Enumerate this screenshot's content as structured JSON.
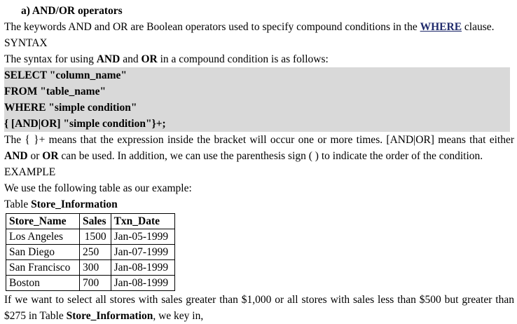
{
  "heading": "a) AND/OR operators",
  "intro": {
    "before": "The keywords AND and OR are Boolean operators used to specify compound conditions in the ",
    "keyword": "WHERE",
    "after": " clause."
  },
  "syntax_label": "SYNTAX",
  "syntax_intro": {
    "part1": "The syntax for using ",
    "and": "AND",
    "part2": " and ",
    "or": "OR",
    "part3": " in a compound condition is as follows:"
  },
  "code_lines": [
    "SELECT \"column_name\"",
    "FROM \"table_name\"",
    "WHERE \"simple condition\"",
    "{ [AND|OR] \"simple condition\"}+;"
  ],
  "explanation": {
    "line1": "The { }+ means that the expression inside the bracket will occur one or more times. [AND|OR] means that either",
    "and": "AND",
    "mid1": " or ",
    "or": "OR",
    "rest": " can be used. In addition, we can use the parenthesis sign ( ) to indicate the order of the condition."
  },
  "example_label": "EXAMPLE",
  "example_intro": "We use the following table as our example:",
  "table_caption": {
    "prefix": "Table ",
    "name": "Store_Information"
  },
  "table": {
    "headers": [
      "Store_Name",
      "Sales",
      "Txn_Date"
    ],
    "rows": [
      [
        "Los Angeles",
        "1500",
        "Jan-05-1999"
      ],
      [
        "San Diego",
        "250",
        "Jan-07-1999"
      ],
      [
        "San Francisco",
        "300",
        "Jan-08-1999"
      ],
      [
        "Boston",
        "700",
        "Jan-08-1999"
      ]
    ]
  },
  "closing": {
    "line1": "If we want to select all stores with sales greater than $1,000 or all stores with sales less than $500 but greater than",
    "line2_prefix": "$275 in Table ",
    "table_name": "Store_Information",
    "line2_suffix": ", we key in,"
  }
}
